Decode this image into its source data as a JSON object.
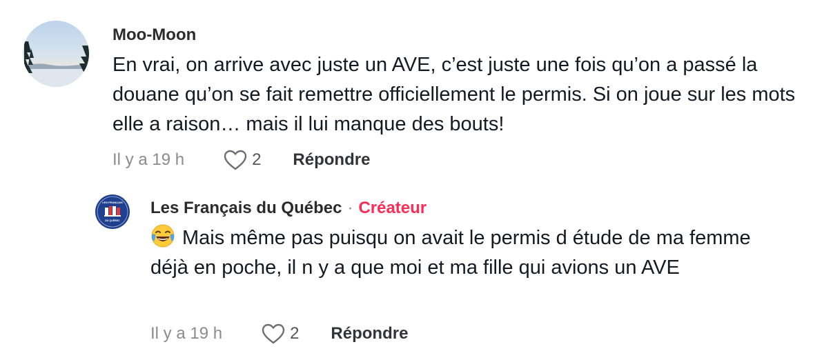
{
  "comments": [
    {
      "author": "Moo-Moon",
      "text": "En vrai, on arrive avec juste un AVE, c’est juste une fois qu’on a passé la douane qu’on se fait remettre officiellement le permis. Si on joue sur les mots elle a raison… mais il lui manque des bouts!",
      "time": "Il y a 19 h",
      "likes": "2",
      "reply_label": "Répondre",
      "avatar_icon": "winter-landscape-avatar"
    }
  ],
  "reply": {
    "author": "Les Français du Québec",
    "separator": "·",
    "badge": "Créateur",
    "emoji": "face-with-tears-of-joy",
    "text": "Mais même pas puisqu on avait le permis d étude de ma femme déjà en poche, il n y a que moi et ma fille qui avions un AVE",
    "time": "Il y a 19 h",
    "likes": "2",
    "reply_label": "Répondre",
    "avatar_icon": "les-francais-du-quebec-logo",
    "avatar_text_top": "LES FRANÇAIS",
    "avatar_text_bottom": "DU QUÉBEC"
  },
  "colors": {
    "creator_badge": "#fe2c55",
    "meta_gray": "#8a8b91",
    "text": "#161823",
    "avatar_blue": "#1f3f8f"
  }
}
